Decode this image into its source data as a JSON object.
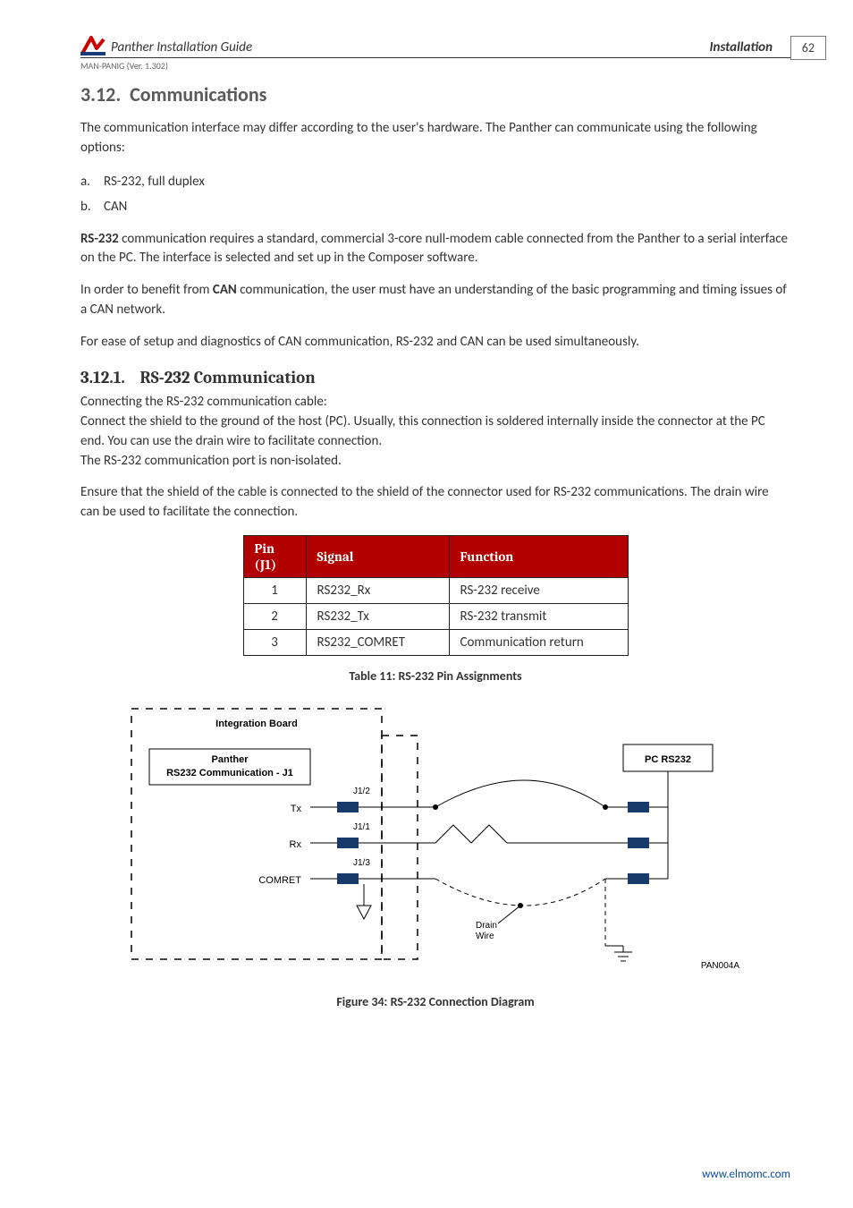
{
  "header": {
    "guide_title": "Panther Installation Guide",
    "section_label": "Installation",
    "page_number": "62",
    "version": "MAN-PANIG (Ver. 1.302)"
  },
  "section": {
    "number": "3.12.",
    "title": "Communications",
    "intro": "The communication interface may differ according to the user's hardware. The Panther can communicate using the following options:",
    "options": [
      {
        "label": "a.",
        "text": "RS-232, full duplex"
      },
      {
        "label": "b.",
        "text": "CAN"
      }
    ],
    "rs232_para_pre": "RS-232",
    "rs232_para": " communication requires a standard, commercial 3-core null-modem cable connected from the Panther to a serial interface on the PC. The interface is selected and set up in the Composer software.",
    "can_para_pre": "In order to benefit from ",
    "can_bold": "CAN",
    "can_para_post": " communication, the user must have an understanding of the basic programming and timing issues of a CAN network.",
    "ease_para": "For ease of setup and diagnostics of CAN communication, RS-232 and CAN can be used simultaneously."
  },
  "subsection": {
    "number": "3.12.1.",
    "title": "RS-232 Communication",
    "p1": "Connecting the RS-232 communication cable:",
    "p2": "Connect the shield to the ground of the host (PC). Usually, this connection is soldered internally inside the connector at the PC end. You can use the drain wire to facilitate connection.",
    "p3": "The RS-232 communication port is non-isolated.",
    "p4": "Ensure that the shield of the cable is connected to the shield of the connector used for RS-232 communications. The drain wire can be used to facilitate the connection."
  },
  "table": {
    "headers": {
      "pin": "Pin (J1)",
      "signal": "Signal",
      "function": "Function"
    },
    "rows": [
      {
        "pin": "1",
        "signal": "RS232_Rx",
        "function": "RS-232 receive"
      },
      {
        "pin": "2",
        "signal": "RS232_Tx",
        "function": "RS-232 transmit"
      },
      {
        "pin": "3",
        "signal": "RS232_COMRET",
        "function": "Communication return"
      }
    ],
    "caption": "Table 11: RS-232 Pin Assignments"
  },
  "figure": {
    "labels": {
      "integration_board": "Integration Board",
      "panther": "Panther",
      "panther_sub": "RS232 Communication - J1",
      "pc": "PC RS232",
      "tx": "Tx",
      "rx": "Rx",
      "comret": "COMRET",
      "j12": "J1/2",
      "j11": "J1/1",
      "j13": "J1/3",
      "drain": "Drain",
      "wire": "Wire",
      "code": "PAN004A"
    },
    "caption": "Figure 34: RS-232 Connection Diagram"
  },
  "footer": {
    "url": "www.elmomc.com"
  }
}
